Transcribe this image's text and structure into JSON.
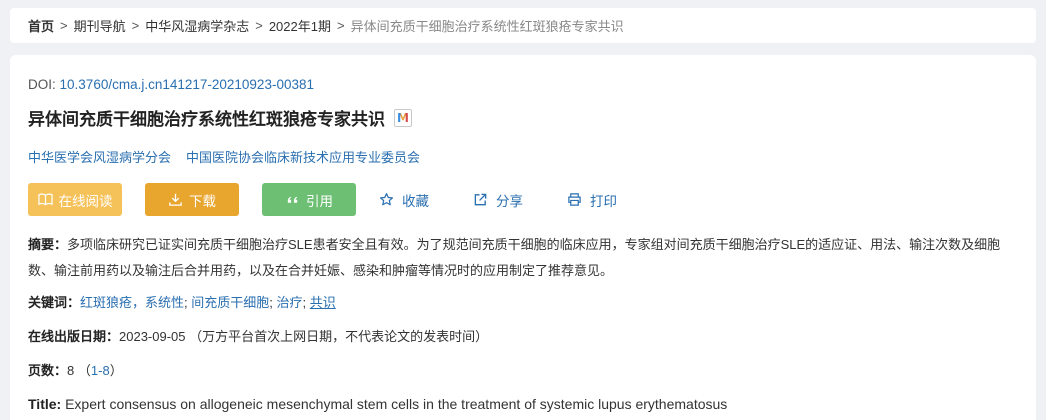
{
  "breadcrumb": {
    "home": "首页",
    "items": [
      "期刊导航",
      "中华风湿病学杂志",
      "2022年1期"
    ],
    "current": "异体间充质干细胞治疗系统性红斑狼疮专家共识",
    "separator": ">"
  },
  "article": {
    "doi_label": "DOI:",
    "doi_value": "10.3760/cma.j.cn141217-20210923-00381",
    "title": "异体间充质干细胞治疗系统性红斑狼疮专家共识",
    "title_badge": "M",
    "authors": [
      "中华医学会风湿病学分会",
      "中国医院协会临床新技术应用专业委员会"
    ]
  },
  "actions": {
    "read": "在线阅读",
    "download": "下载",
    "cite": "引用",
    "favorite": "收藏",
    "share": "分享",
    "print": "打印"
  },
  "abstract": {
    "label": "摘要：",
    "text": "多项临床研究已证实间充质干细胞治疗SLE患者安全且有效。为了规范间充质干细胞的临床应用，专家组对间充质干细胞治疗SLE的适应证、用法、输注次数及细胞数、输注前用药以及输注后合并用药，以及在合并妊娠、感染和肿瘤等情况时的应用制定了推荐意见。"
  },
  "keywords": {
    "label": "关键词：",
    "items": [
      "红斑狼疮，系统性",
      "间充质干细胞",
      "治疗",
      "共识"
    ],
    "sep": "; "
  },
  "pubdate": {
    "label": "在线出版日期：",
    "value": "2023-09-05",
    "note": "（万方平台首次上网日期，不代表论文的发表时间）"
  },
  "pages": {
    "label": "页数：",
    "count": "8",
    "open": "（",
    "range": "1-8",
    "close": "）"
  },
  "title_en": {
    "label": "Title:",
    "value": "Expert consensus on allogeneic mesenchymal stem cells in the treatment of systemic lupus erythematosus"
  },
  "colors": {
    "link": "#2a6fb0",
    "read_button": "#f5c25a",
    "download_button": "#e8a62f",
    "cite_button": "#6cbf73"
  }
}
